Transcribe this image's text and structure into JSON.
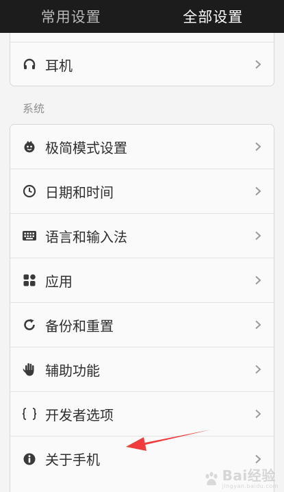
{
  "tabs": [
    {
      "label": "常用设置",
      "active": false
    },
    {
      "label": "全部设置",
      "active": true
    }
  ],
  "top_group": {
    "items": [
      {
        "label": "耳机",
        "icon": "headphones-icon"
      }
    ]
  },
  "system_section": {
    "title": "系统",
    "items": [
      {
        "label": "极简模式设置",
        "icon": "simple-mode-icon"
      },
      {
        "label": "日期和时间",
        "icon": "clock-icon"
      },
      {
        "label": "语言和输入法",
        "icon": "keyboard-icon"
      },
      {
        "label": "应用",
        "icon": "apps-icon"
      },
      {
        "label": "备份和重置",
        "icon": "backup-icon"
      },
      {
        "label": "辅助功能",
        "icon": "hand-icon"
      },
      {
        "label": "开发者选项",
        "icon": "braces-icon"
      },
      {
        "label": "关于手机",
        "icon": "info-icon"
      }
    ]
  },
  "annotation": {
    "color": "#f03c3c"
  },
  "watermark": {
    "text": "Bai经验",
    "sub": "jingyan.baidu.com"
  },
  "colors": {
    "tabbar_bg": "#1c1c1c",
    "page_bg": "#f4f4f4",
    "card_bg": "#fafafa",
    "text": "#2f2f2f",
    "section_text": "#8f8f8f"
  }
}
